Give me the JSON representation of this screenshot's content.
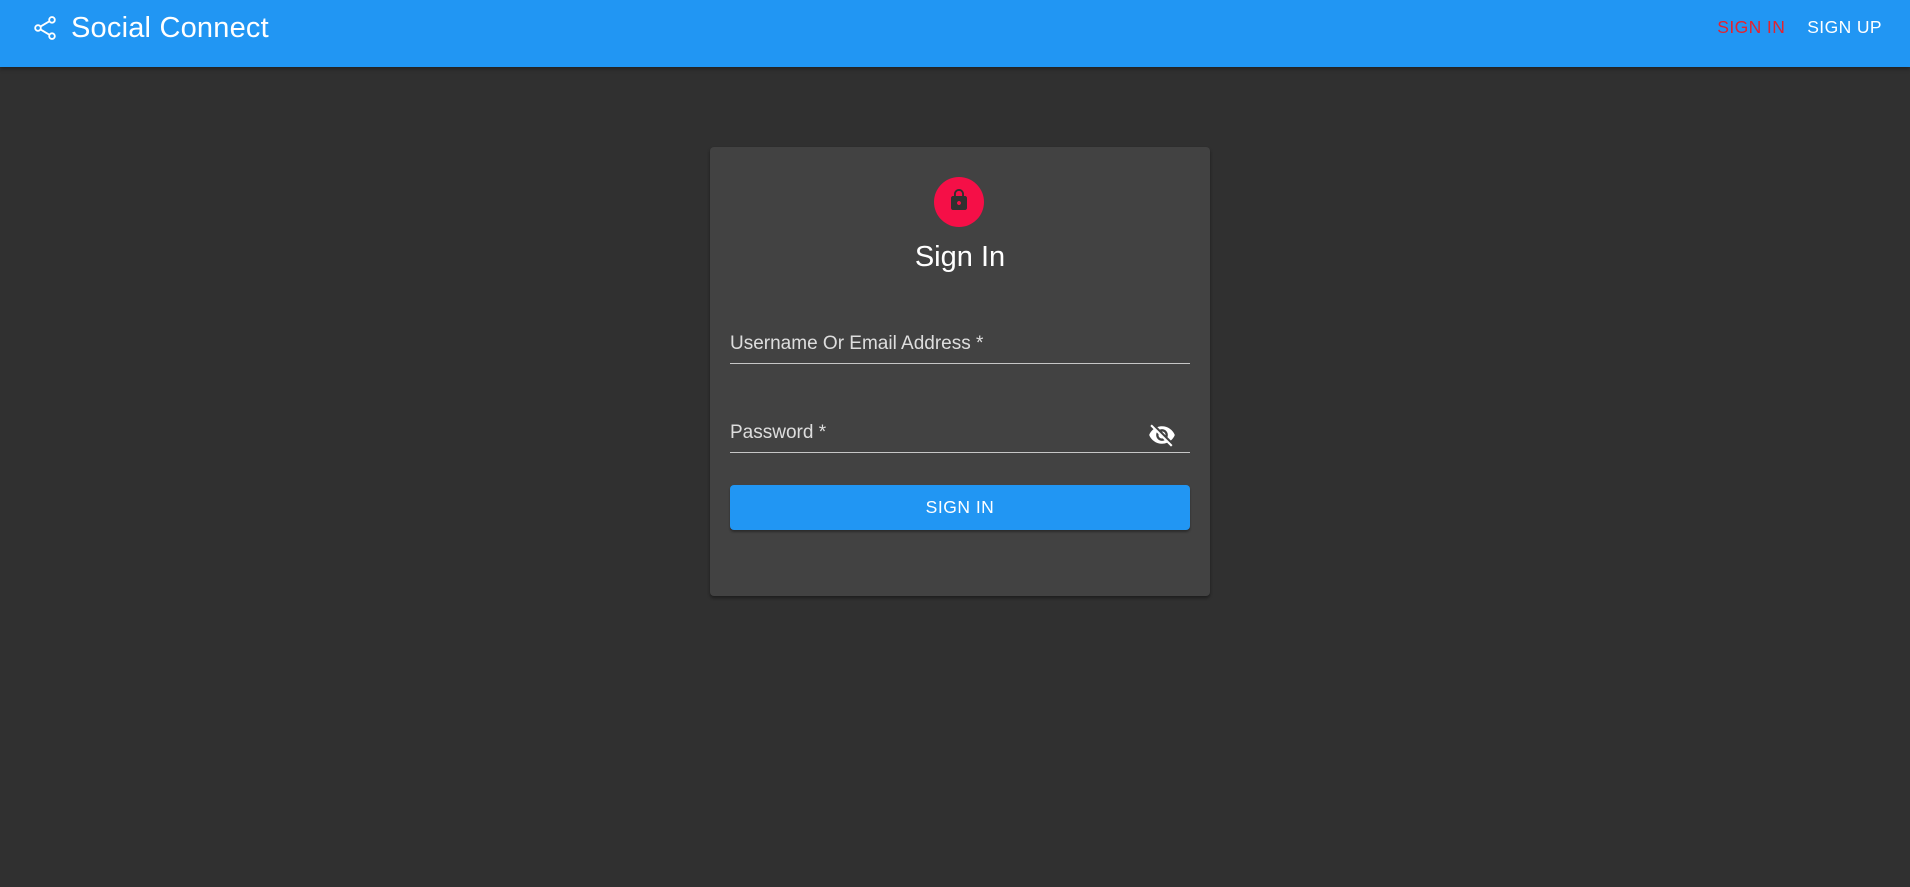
{
  "app": {
    "title": "Social Connect",
    "brand_icon": "share-icon"
  },
  "nav": {
    "items": [
      {
        "label": "SIGN IN",
        "active": true
      },
      {
        "label": "SIGN UP",
        "active": false
      }
    ]
  },
  "form": {
    "avatar_icon": "lock-icon",
    "title": "Sign In",
    "username": {
      "placeholder": "Username Or Email Address *",
      "value": ""
    },
    "password": {
      "placeholder": "Password *",
      "value": "",
      "toggle_icon": "visibility-off-icon"
    },
    "submit_label": "SIGN IN"
  },
  "colors": {
    "appbar": "#2196f3",
    "background": "#303030",
    "card": "#424242",
    "avatar": "#f50f47",
    "active_nav": "#e5222e",
    "button": "#2196f3"
  }
}
